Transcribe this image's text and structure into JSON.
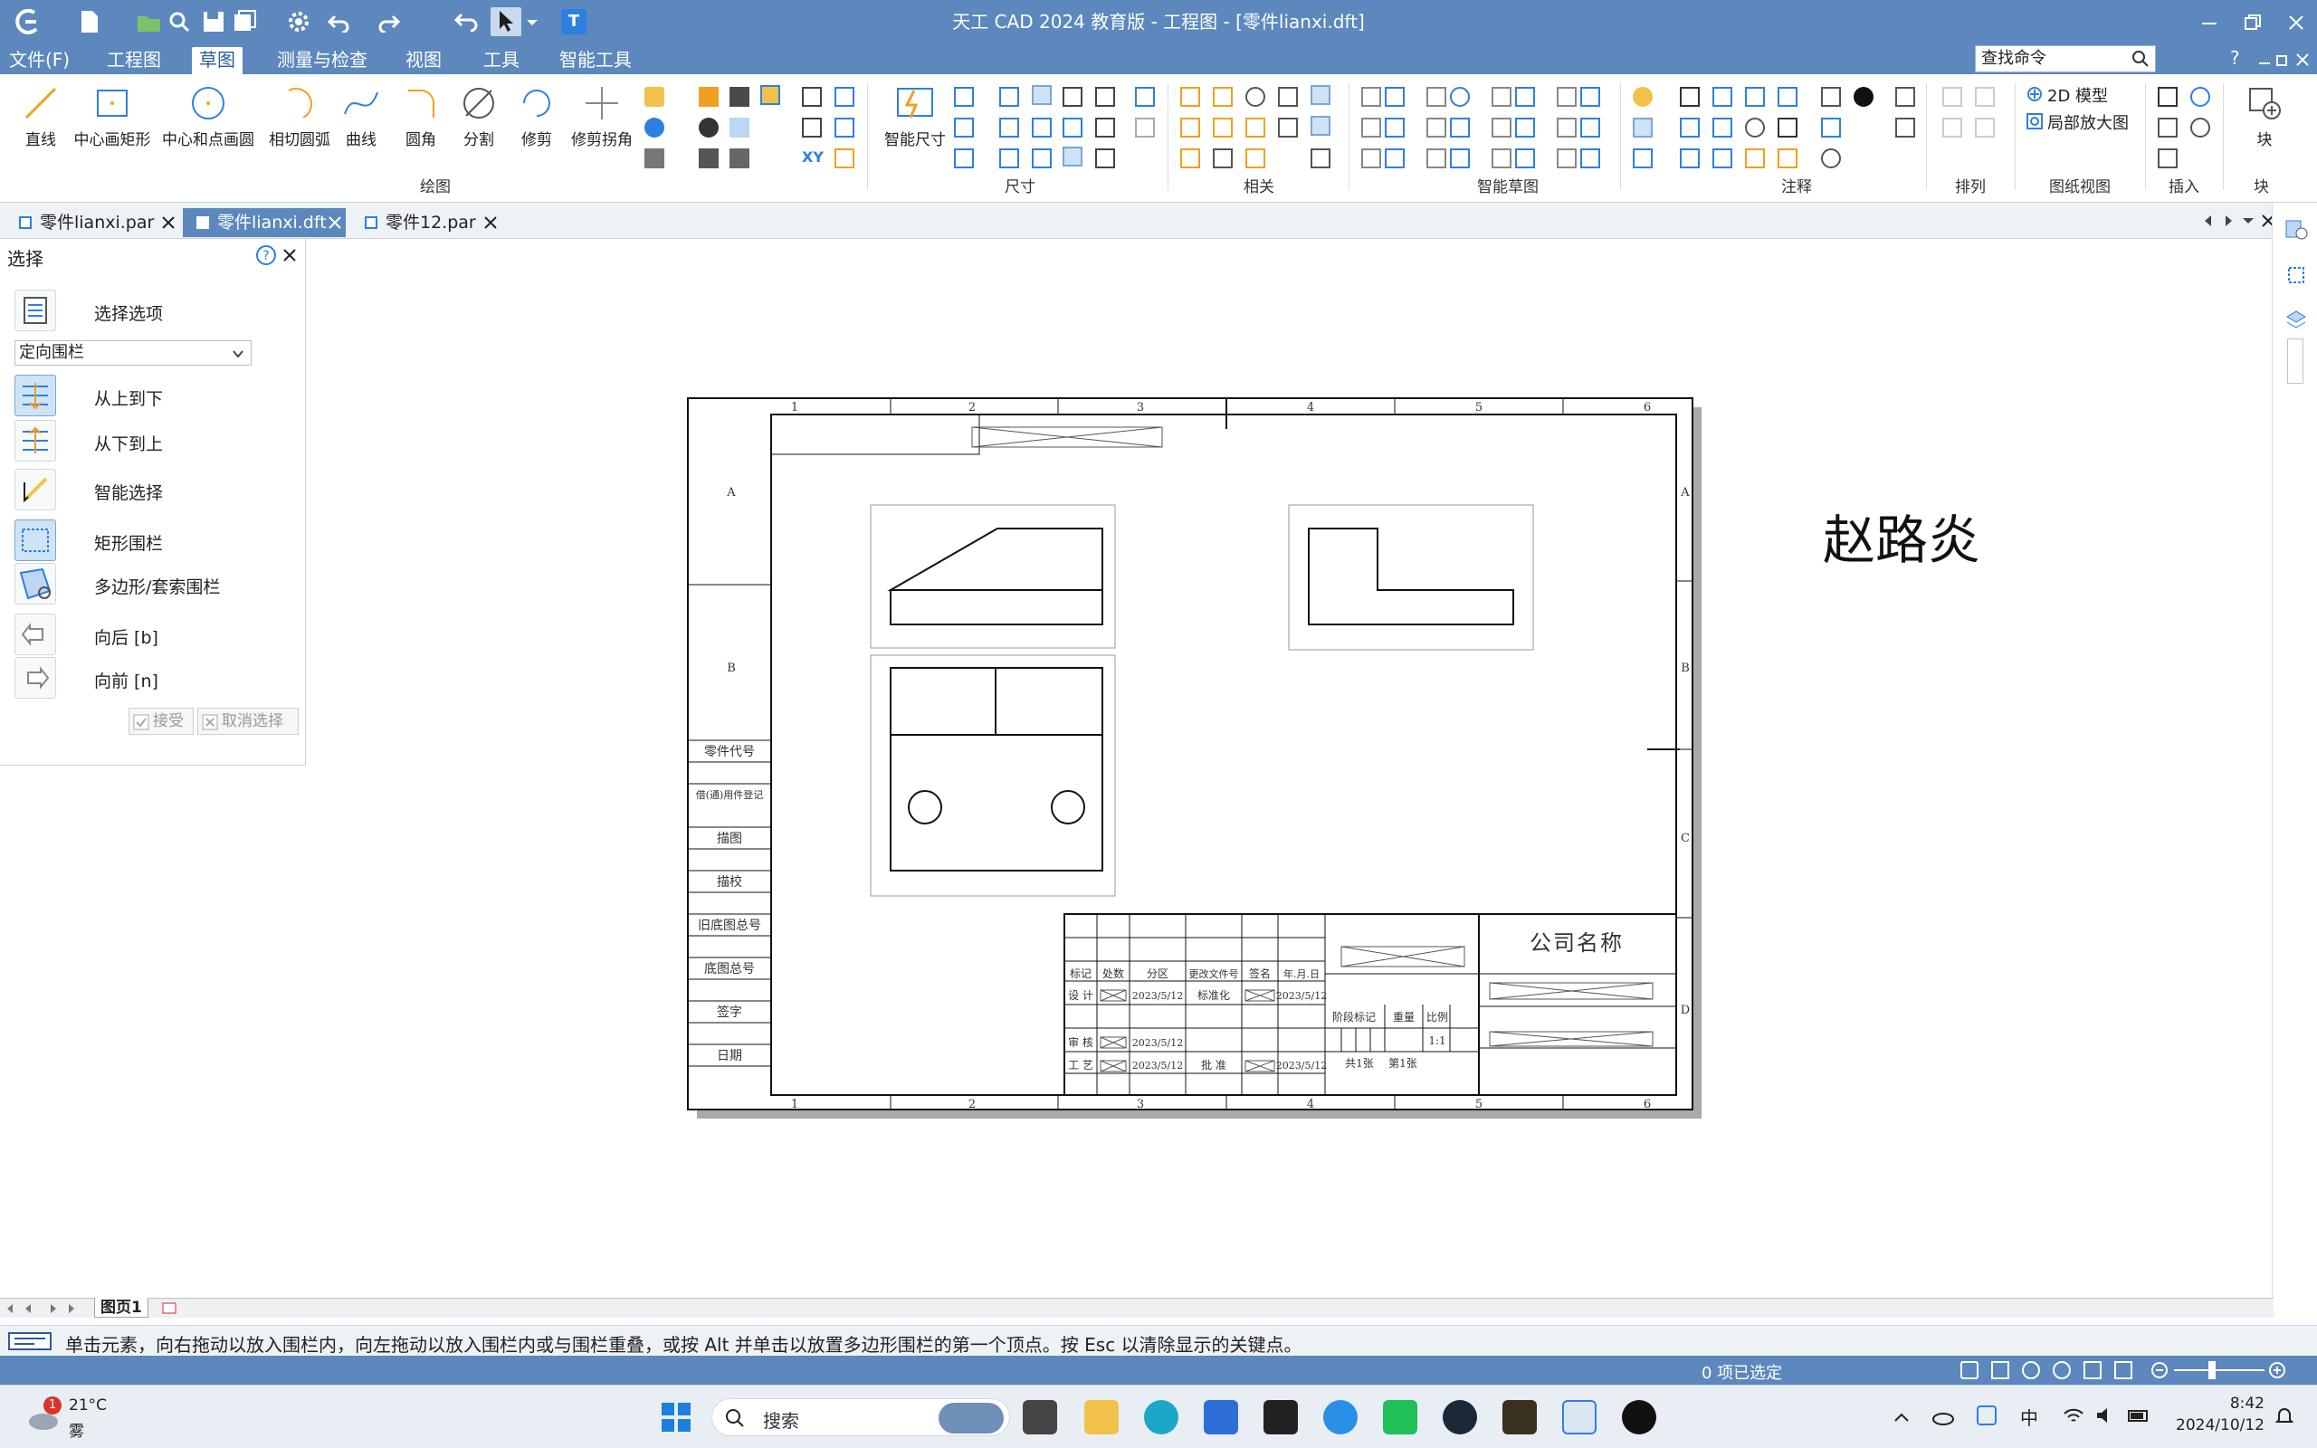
{
  "window": {
    "title": "天工 CAD 2024 教育版 - 工程图 - [零件lianxi.dft]",
    "search_placeholder": "查找命令",
    "help_glyph": "?"
  },
  "menu": {
    "items": [
      "文件(F)",
      "工程图",
      "草图",
      "测量与检查",
      "视图",
      "工具",
      "智能工具"
    ],
    "active_index": 2
  },
  "ribbon": {
    "draw_tools": [
      "直线",
      "中心画矩形",
      "中心和点画圆",
      "相切圆弧",
      "曲线",
      "圆角",
      "分割",
      "修剪",
      "修剪拐角"
    ],
    "smart_dim_label": "智能尺寸",
    "model_2d_label": "2D 模型",
    "detail_view_label": "局部放大图",
    "block_label": "块",
    "group_labels": {
      "draw": "绘图",
      "dimension": "尺寸",
      "relate": "相关",
      "smart_sketch": "智能草图",
      "annotation": "注释",
      "arrange": "排列",
      "drawing_view": "图纸视图",
      "insert": "插入",
      "block": "块"
    }
  },
  "doc_tabs": [
    {
      "label": "零件lianxi.par",
      "active": false
    },
    {
      "label": "零件lianxi.dft",
      "active": true
    },
    {
      "label": "零件12.par",
      "active": false
    }
  ],
  "select_panel": {
    "title": "选择",
    "options_label": "选择选项",
    "fence_mode": "定向围栏",
    "top_to_bottom": "从上到下",
    "bottom_to_top": "从下到上",
    "smart_select": "智能选择",
    "rect_fence": "矩形围栏",
    "polygon_fence": "多边形/套索围栏",
    "back": "向后 [b]",
    "forward": "向前 [n]",
    "accept": "接受",
    "cancel": "取消选择"
  },
  "drawing": {
    "name_text": "赵路炎",
    "company": "公司名称",
    "col_numbers": [
      "1",
      "2",
      "3",
      "4",
      "5",
      "6"
    ],
    "row_letters": [
      "A",
      "B",
      "C",
      "D"
    ],
    "left_strip_labels": [
      "零件代号",
      "借(通)用件登记",
      "描图",
      "描校",
      "旧底图总号",
      "底图总号",
      "签字",
      "日期"
    ],
    "title_block": {
      "headers": [
        "标记",
        "处数",
        "分区",
        "更改文件号",
        "签名",
        "年.月.日"
      ],
      "design": "设 计",
      "review": "审 核",
      "process": "工 艺",
      "standardize": "标准化",
      "approve": "批 准",
      "date": "2023/5/12",
      "stage_mark": "阶段标记",
      "weight": "重量",
      "scale_label": "比例",
      "scale_value": "1:1",
      "total_sheets": "共1张",
      "sheet_no": "第1张"
    }
  },
  "sheet_tab": "图页1",
  "prompt": "单击元素，向右拖动以放入围栏内，向左拖动以放入围栏内或与围栏重叠，或按 Alt 并单击以放置多边形围栏的第一个顶点。按 Esc 以清除显示的关键点。",
  "status": {
    "selected": "0 项已选定"
  },
  "taskbar": {
    "weather_temp": "21°C",
    "weather_desc": "雾",
    "weather_badge": "1",
    "search": "搜索",
    "ime": "中",
    "time": "8:42",
    "date": "2024/10/12"
  },
  "colors": {
    "titlebar": "#5c88bd",
    "accent": "#2a5aa0"
  }
}
